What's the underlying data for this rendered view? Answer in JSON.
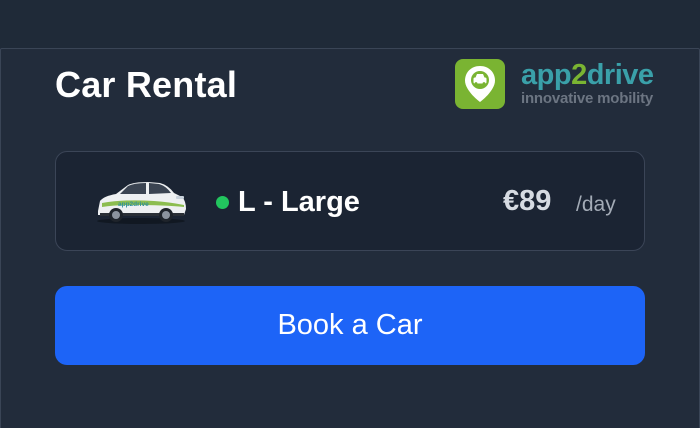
{
  "title": "Car Rental",
  "brand": {
    "name_part1": "app",
    "name_part2": "2",
    "name_part3": "drive",
    "tagline": "innovative mobility",
    "icon": "map-pin-car-icon",
    "icon_bg": "#7ab432"
  },
  "vehicle": {
    "image": "car-thumbnail",
    "status_color": "#22c55e",
    "class_label": "L - Large",
    "price": "€89",
    "price_unit": "/day"
  },
  "book_button": {
    "label": "Book a Car",
    "color": "#1d64f7"
  }
}
